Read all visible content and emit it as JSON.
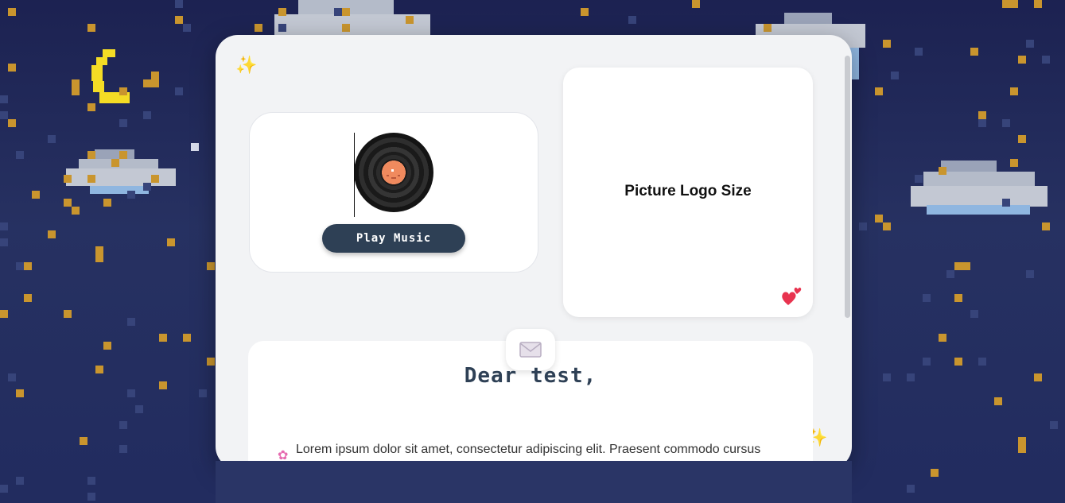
{
  "music": {
    "play_label": "Play Music"
  },
  "picture": {
    "label": "Picture Logo Size"
  },
  "letter": {
    "greeting": "Dear test,",
    "body": "Lorem ipsum dolor sit amet, consectetur adipiscing elit. Praesent commodo cursus"
  },
  "icons": {
    "sparkle": "sparkle-icon",
    "envelope": "envelope-icon",
    "hearts": "hearts-icon",
    "flower": "flower-icon",
    "vinyl": "vinyl-record-icon",
    "moon": "moon-icon"
  },
  "colors": {
    "background": "#26305f",
    "card": "#f2f3f5",
    "button": "#2e4055",
    "star": "#c9952e",
    "moon": "#f4dc25"
  }
}
